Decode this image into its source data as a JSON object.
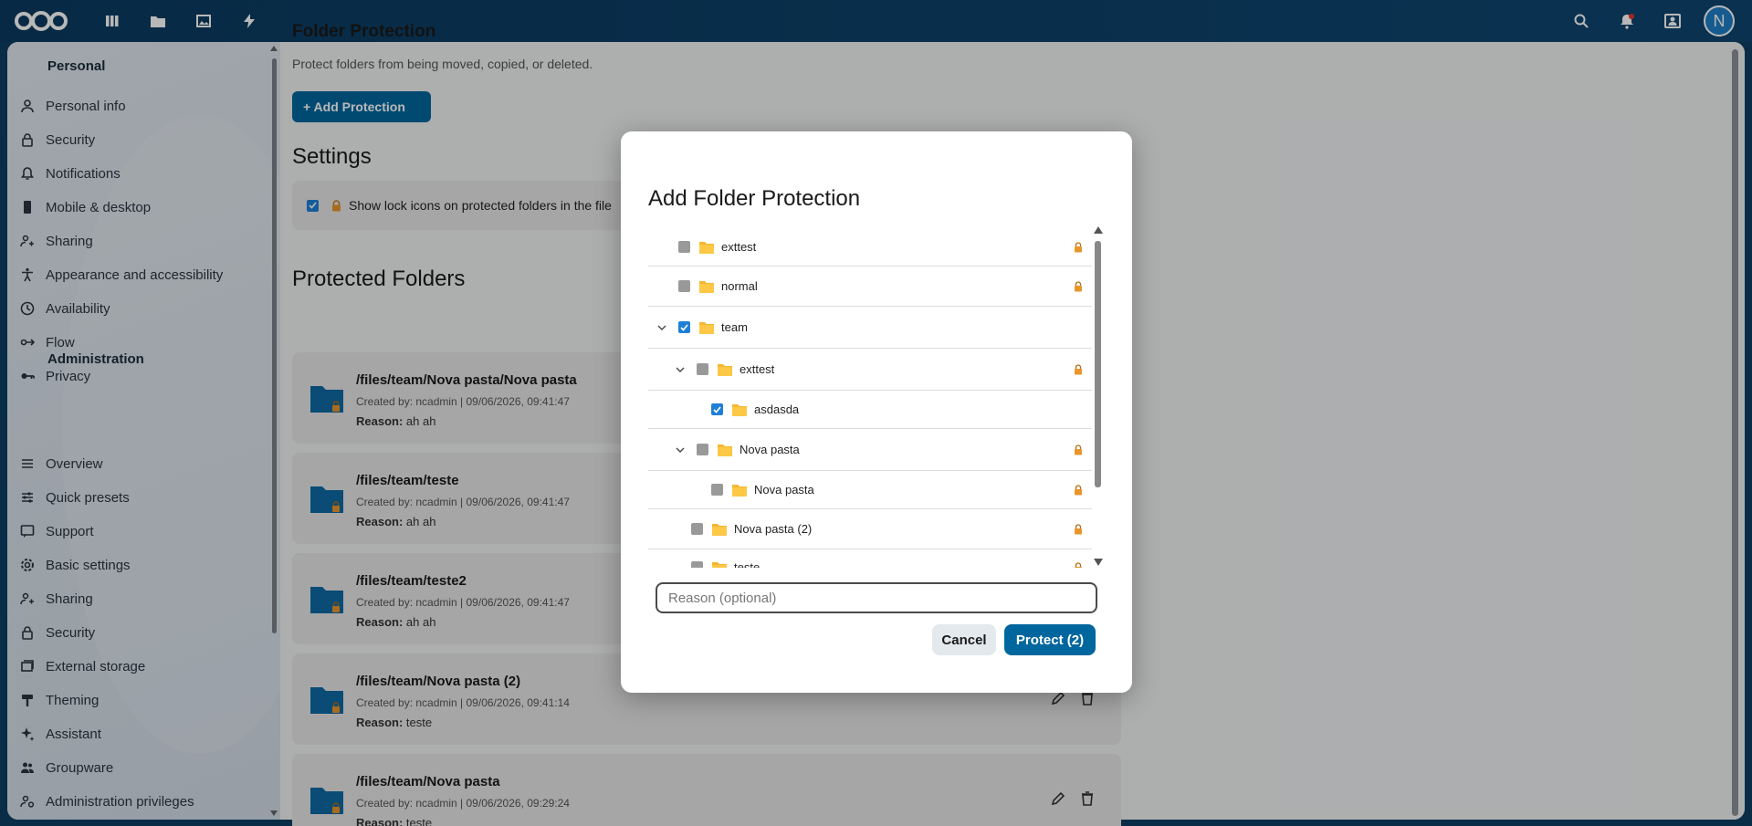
{
  "header": {
    "apps": [
      "dashboard-icon",
      "files-icon",
      "photos-icon",
      "activity-icon"
    ],
    "right": [
      "search-icon",
      "notifications-icon",
      "contacts-icon"
    ],
    "avatar_initial": "N"
  },
  "sidebar": {
    "personal_heading": "Personal",
    "personal_items": [
      {
        "label": "Personal info",
        "icon": "person-icon"
      },
      {
        "label": "Security",
        "icon": "lock-icon"
      },
      {
        "label": "Notifications",
        "icon": "bell-icon"
      },
      {
        "label": "Mobile & desktop",
        "icon": "phone-icon"
      },
      {
        "label": "Sharing",
        "icon": "share-icon"
      },
      {
        "label": "Appearance and accessibility",
        "icon": "accessibility-icon"
      },
      {
        "label": "Availability",
        "icon": "clock-icon"
      },
      {
        "label": "Flow",
        "icon": "flow-icon"
      },
      {
        "label": "Privacy",
        "icon": "key-icon"
      }
    ],
    "admin_heading": "Administration",
    "admin_items": [
      {
        "label": "Overview",
        "icon": "list-icon"
      },
      {
        "label": "Quick presets",
        "icon": "sliders-icon"
      },
      {
        "label": "Support",
        "icon": "chat-icon"
      },
      {
        "label": "Basic settings",
        "icon": "gear-icon"
      },
      {
        "label": "Sharing",
        "icon": "share-icon"
      },
      {
        "label": "Security",
        "icon": "lock-icon"
      },
      {
        "label": "External storage",
        "icon": "storage-icon"
      },
      {
        "label": "Theming",
        "icon": "paint-icon"
      },
      {
        "label": "Assistant",
        "icon": "sparkle-icon"
      },
      {
        "label": "Groupware",
        "icon": "group-icon"
      },
      {
        "label": "Administration privileges",
        "icon": "admin-icon"
      }
    ]
  },
  "main": {
    "title": "Folder Protection",
    "description": "Protect folders from being moved, copied, or deleted.",
    "add_button": "+ Add Protection",
    "settings_heading": "Settings",
    "settings_option": "Show lock icons on protected folders in the file",
    "protected_heading": "Protected Folders",
    "folders": [
      {
        "path": "/files/team/Nova pasta/Nova pasta",
        "meta": "Created by: ncadmin | 09/06/2026, 09:41:47",
        "reason_label": "Reason:",
        "reason": "ah ah"
      },
      {
        "path": "/files/team/teste",
        "meta": "Created by: ncadmin | 09/06/2026, 09:41:47",
        "reason_label": "Reason:",
        "reason": "ah ah"
      },
      {
        "path": "/files/team/teste2",
        "meta": "Created by: ncadmin | 09/06/2026, 09:41:47",
        "reason_label": "Reason:",
        "reason": "ah ah"
      },
      {
        "path": "/files/team/Nova pasta (2)",
        "meta": "Created by: ncadmin | 09/06/2026, 09:41:14",
        "reason_label": "Reason:",
        "reason": "teste"
      },
      {
        "path": "/files/team/Nova pasta",
        "meta": "Created by: ncadmin | 09/06/2026, 09:29:24",
        "reason_label": "Reason:",
        "reason": "teste"
      }
    ]
  },
  "modal": {
    "title": "Add Folder Protection",
    "tree": [
      {
        "name": "exttest",
        "checked": false,
        "expanded": null,
        "locked": true
      },
      {
        "name": "normal",
        "checked": false,
        "expanded": null,
        "locked": true
      },
      {
        "name": "team",
        "checked": true,
        "expanded": true,
        "locked": false
      },
      {
        "name": "exttest",
        "checked": false,
        "expanded": true,
        "locked": true
      },
      {
        "name": "asdasda",
        "checked": true,
        "expanded": null,
        "locked": false
      },
      {
        "name": "Nova pasta",
        "checked": false,
        "expanded": true,
        "locked": true
      },
      {
        "name": "Nova pasta",
        "checked": false,
        "expanded": null,
        "locked": true
      },
      {
        "name": "Nova pasta (2)",
        "checked": false,
        "expanded": null,
        "locked": true
      },
      {
        "name": "teste",
        "checked": false,
        "expanded": null,
        "locked": true
      }
    ],
    "reason_placeholder": "Reason (optional)",
    "cancel_label": "Cancel",
    "protect_label": "Protect (2)"
  },
  "colors": {
    "primary": "#00679e",
    "header": "#0b3a60",
    "folder": "#f5b731",
    "lock": "#e8962b"
  }
}
